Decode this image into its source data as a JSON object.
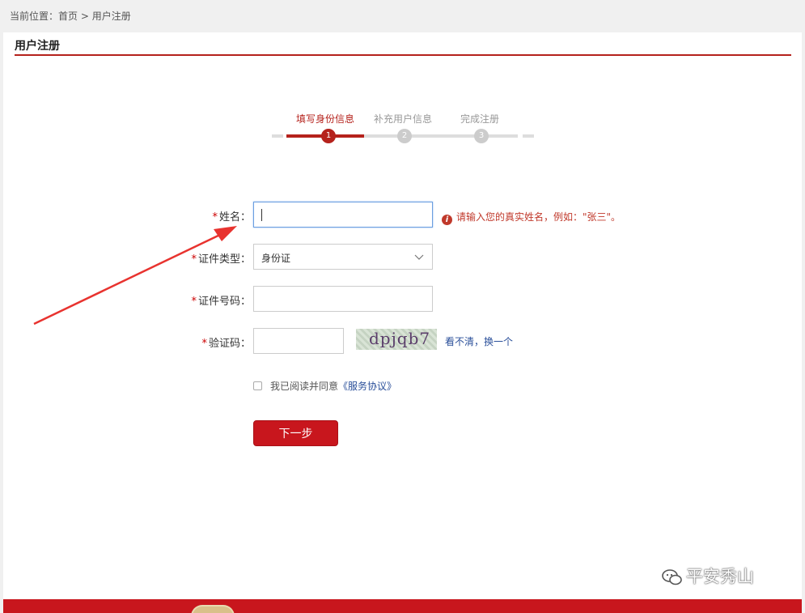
{
  "breadcrumb": {
    "prefix": "当前位置：",
    "home": "首页",
    "sep": " > ",
    "current": "用户注册"
  },
  "page_title": "用户注册",
  "steps": [
    {
      "label": "填写身份信息",
      "num": "1"
    },
    {
      "label": "补充用户信息",
      "num": "2"
    },
    {
      "label": "完成注册",
      "num": "3"
    }
  ],
  "form": {
    "name_label": "姓名：",
    "name_hint": "请输入您的真实姓名，例如：\"张三\"。",
    "idtype_label": "证件类型：",
    "idtype_value": "身份证",
    "idno_label": "证件号码：",
    "captcha_label": "验证码：",
    "captcha_text": "dpjqb7",
    "refresh_text": "看不清，换一个",
    "required_mark": "*",
    "hint_icon": "i",
    "agree_prefix": "我已阅读并同意",
    "agree_link": "《服务协议》",
    "next_label": "下一步"
  },
  "watermark": "平安秀山",
  "colors": {
    "accent": "#b5221c",
    "button": "#c8161d",
    "link": "#2a4f9a",
    "hint": "#c0392b"
  },
  "icons": [
    "info-icon",
    "chevron-down-icon",
    "wechat-icon",
    "arrow-annotation"
  ]
}
